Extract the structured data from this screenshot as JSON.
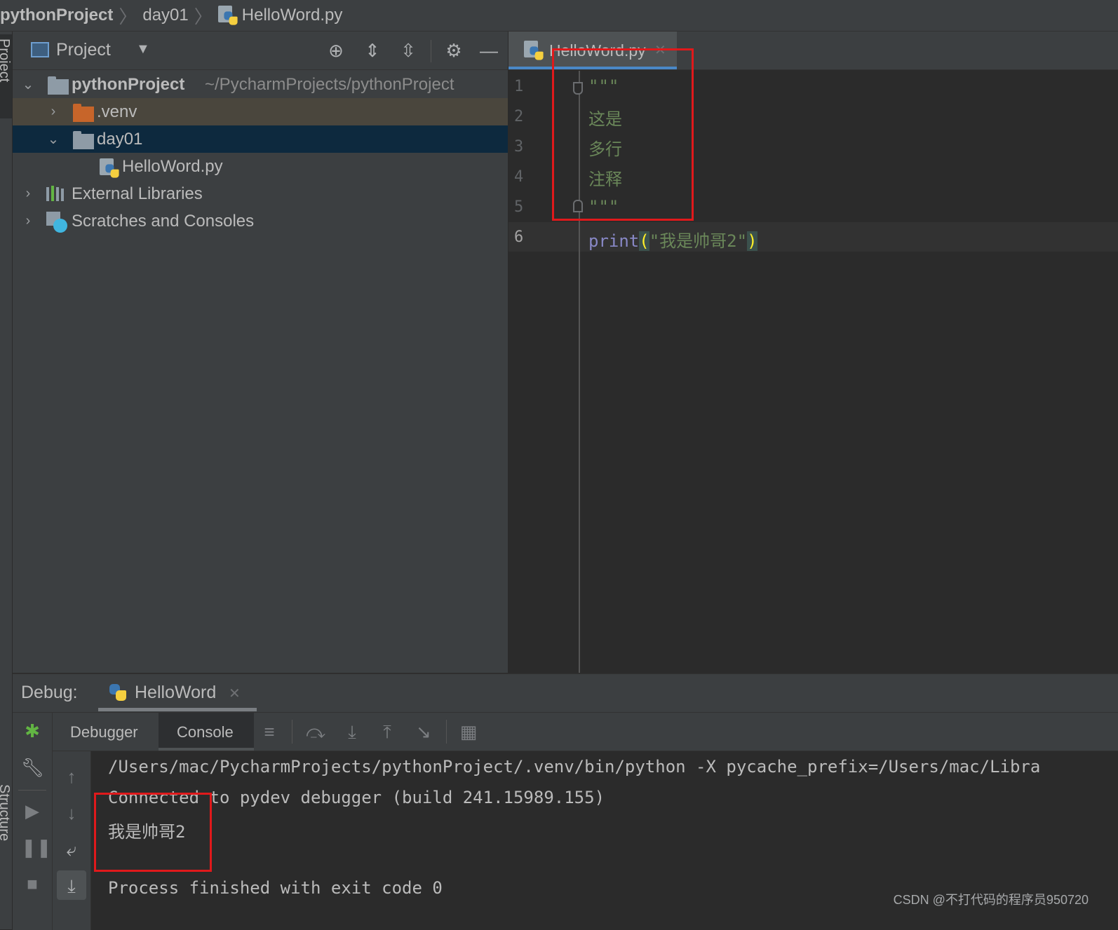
{
  "breadcrumb": {
    "project": "pythonProject",
    "folder": "day01",
    "file": "HelloWord.py"
  },
  "left_stripe": {
    "project_label": "Project",
    "structure_label": "Structure"
  },
  "project_panel": {
    "title": "Project",
    "tree": {
      "root_name": "pythonProject",
      "root_path": "~/PycharmProjects/pythonProject",
      "venv": ".venv",
      "day01": "day01",
      "file": "HelloWord.py",
      "external": "External Libraries",
      "scratches": "Scratches and Consoles"
    }
  },
  "editor": {
    "tab_label": "HelloWord.py",
    "line_numbers": [
      "1",
      "2",
      "3",
      "4",
      "5",
      "6"
    ],
    "lines": {
      "l1": "\"\"\"",
      "l2": "这是",
      "l3": "多行",
      "l4": "注释",
      "l5": "\"\"\"",
      "l6_func": "print",
      "l6_open": "(",
      "l6_str": "\"我是帅哥2\"",
      "l6_close": ")"
    }
  },
  "debug": {
    "label": "Debug:",
    "session_tab": "HelloWord",
    "subtabs": {
      "debugger": "Debugger",
      "console": "Console"
    },
    "console": {
      "line1": "/Users/mac/PycharmProjects/pythonProject/.venv/bin/python -X pycache_prefix=/Users/mac/Libra",
      "line2": "Connected to pydev debugger (build 241.15989.155)",
      "line3": "我是帅哥2",
      "line4": "Process finished with exit code 0"
    }
  },
  "watermark": "CSDN @不打代码的程序员950720",
  "colors": {
    "accent": "#4a88c7",
    "selection": "#0d293e",
    "annotation_red": "#e0191b",
    "string_green": "#6a8759",
    "keyword_purple": "#8888c6",
    "bracket_yellow": "#ffef28"
  }
}
